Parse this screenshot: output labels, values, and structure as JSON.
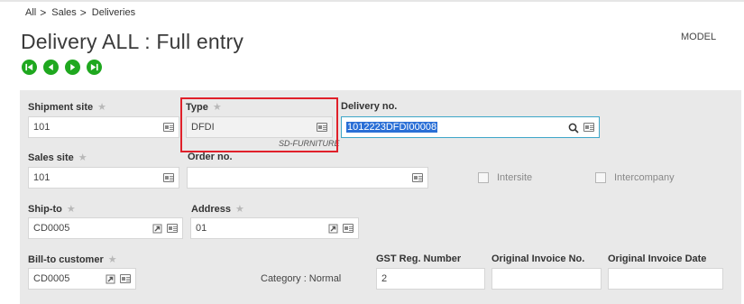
{
  "breadcrumb": {
    "items": [
      "All",
      "Sales",
      "Deliveries"
    ],
    "sep": ">"
  },
  "page": {
    "title": "Delivery ALL : Full entry",
    "model_label": "MODEL"
  },
  "nav_buttons": [
    {
      "name": "first-record-button",
      "icon": "first-record-icon"
    },
    {
      "name": "previous-record-button",
      "icon": "previous-record-icon"
    },
    {
      "name": "next-record-button",
      "icon": "next-record-icon"
    },
    {
      "name": "last-record-button",
      "icon": "last-record-icon"
    }
  ],
  "form": {
    "shipment_site": {
      "label": "Shipment site",
      "value": "101"
    },
    "type": {
      "label": "Type",
      "value": "DFDI",
      "caption": "SD-FURNITURE"
    },
    "delivery_no": {
      "label": "Delivery no.",
      "value": "1012223DFDI00008"
    },
    "sales_site": {
      "label": "Sales site",
      "value": "101"
    },
    "order_no": {
      "label": "Order no.",
      "value": ""
    },
    "intersite": {
      "label": "Intersite",
      "checked": false
    },
    "intercompany": {
      "label": "Intercompany",
      "checked": false
    },
    "ship_to": {
      "label": "Ship-to",
      "value": "CD0005"
    },
    "address": {
      "label": "Address",
      "value": "01"
    },
    "bill_to_customer": {
      "label": "Bill-to customer",
      "value": "CD0005"
    },
    "category": {
      "text": "Category : Normal"
    },
    "gst_reg_number": {
      "label": "GST Reg. Number",
      "value": "2"
    },
    "original_invoice_no": {
      "label": "Original Invoice No.",
      "value": ""
    },
    "original_invoice_date": {
      "label": "Original Invoice Date",
      "value": ""
    }
  },
  "colors": {
    "nav_green": "#1fa81f",
    "highlight_red": "#e0202a",
    "focus_blue": "#3ea6c8",
    "selection_blue": "#2a6fd6",
    "panel_grey": "#e9e9e9"
  }
}
